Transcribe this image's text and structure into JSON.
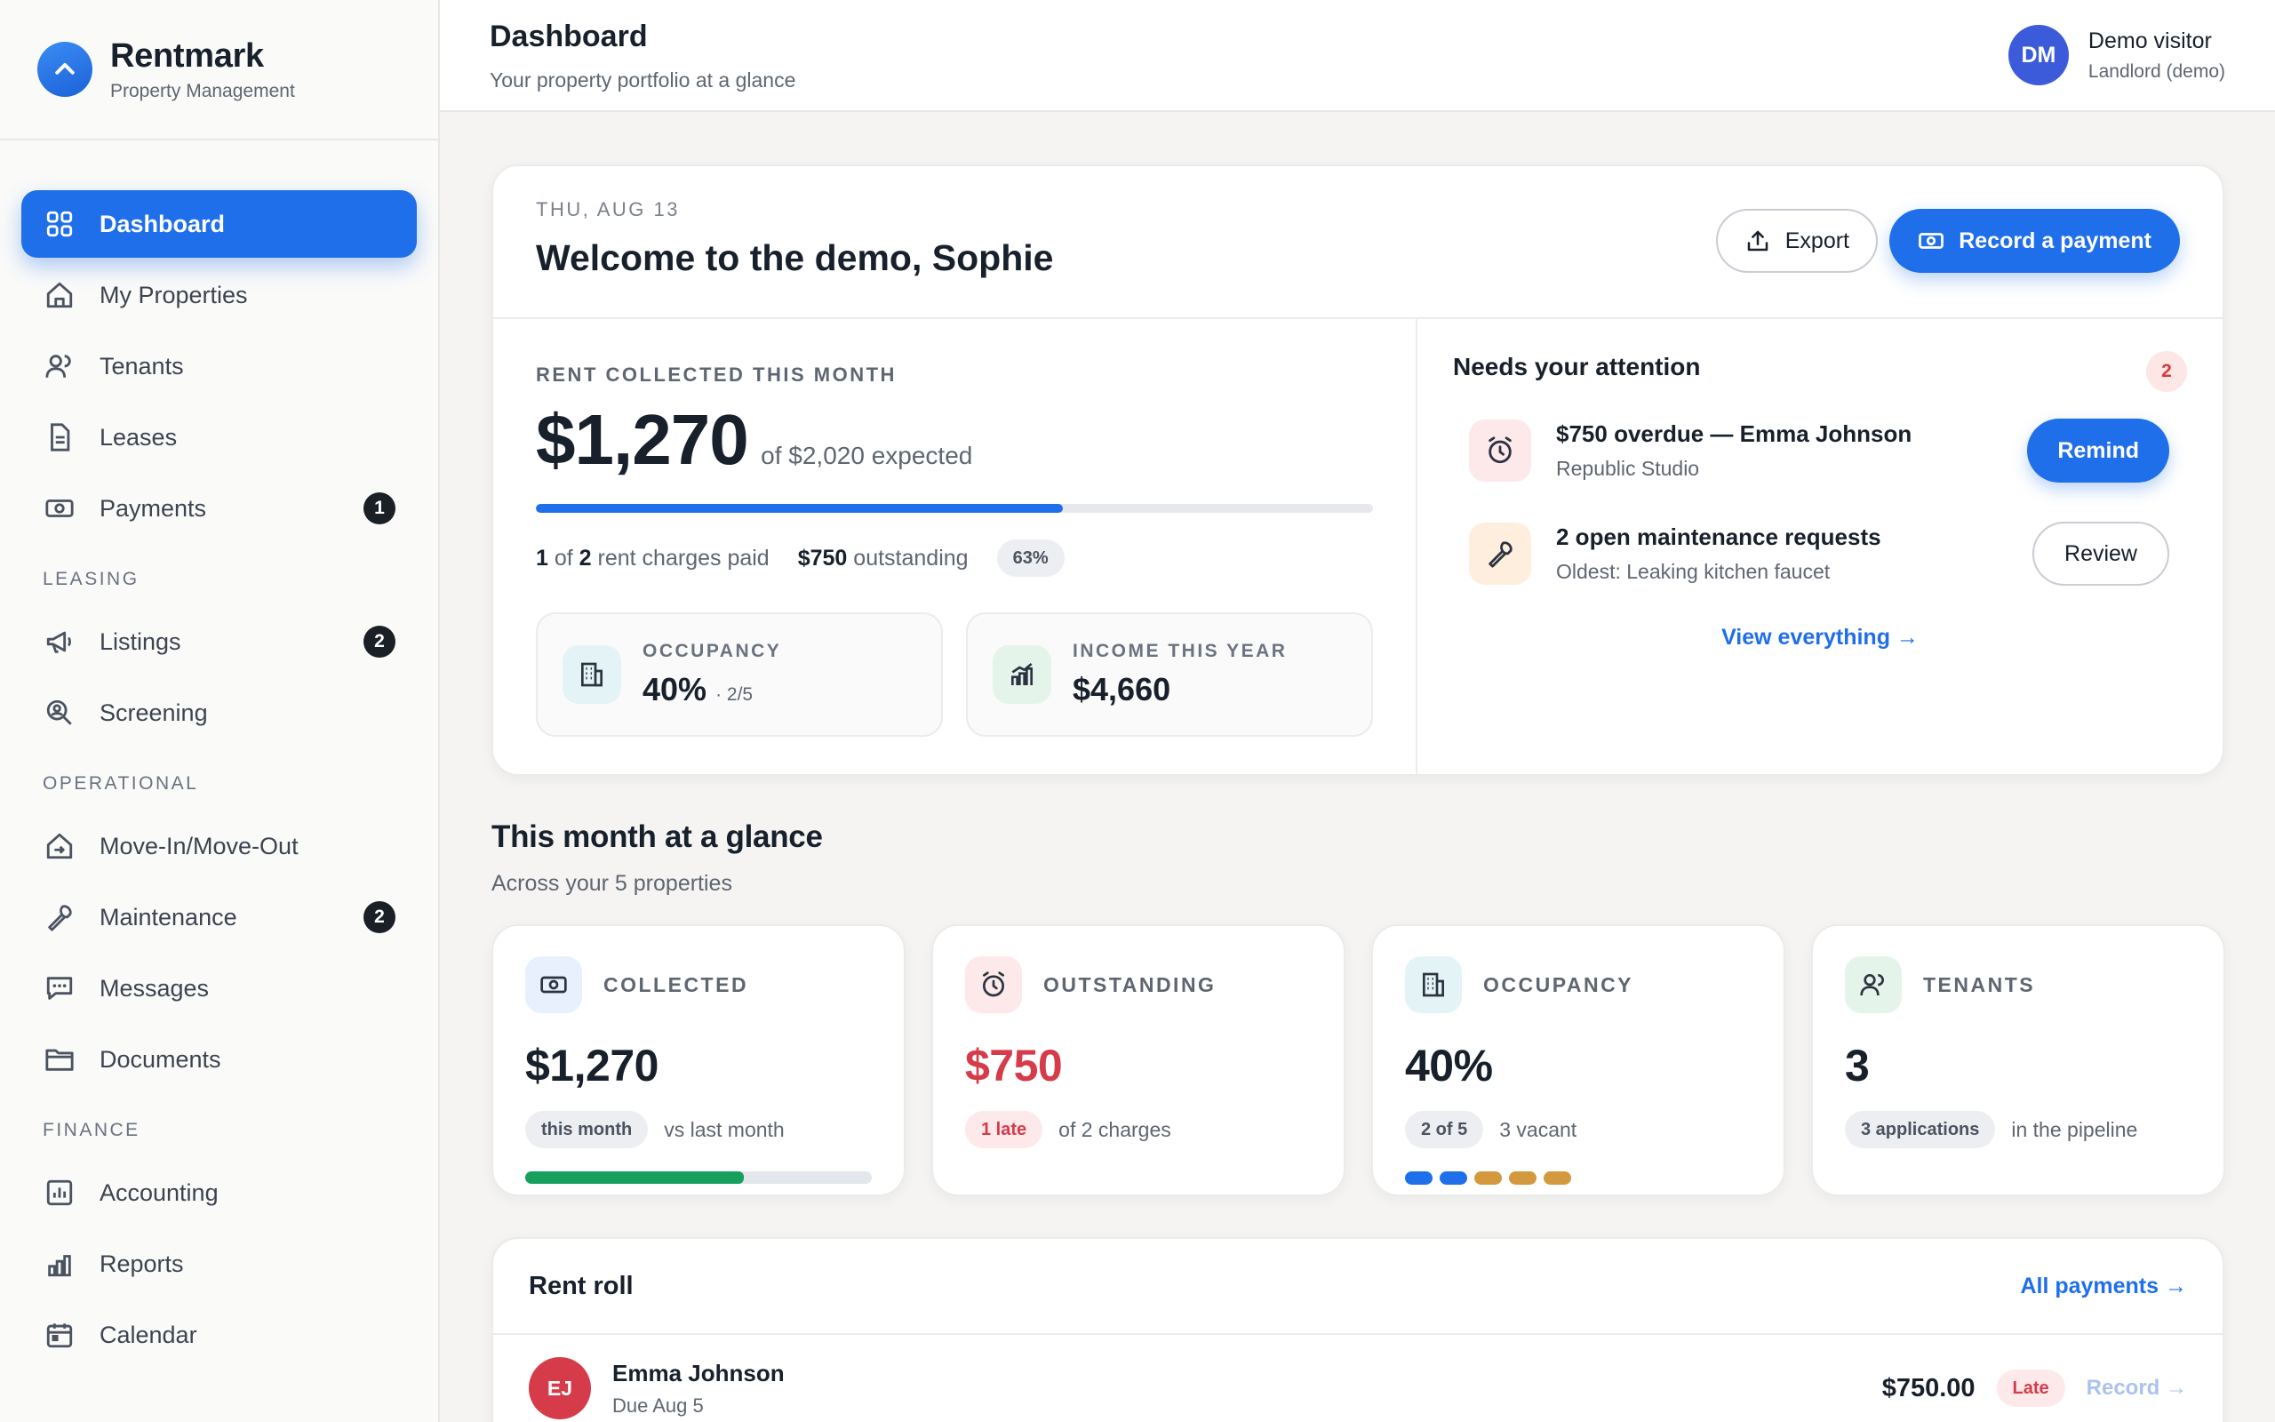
{
  "brand": {
    "name": "Rentmark",
    "subtitle": "Property Management"
  },
  "header": {
    "title": "Dashboard",
    "subtitle": "Your property portfolio at a glance",
    "user": {
      "initials": "DM",
      "name": "Demo visitor",
      "role": "Landlord (demo)"
    }
  },
  "sidebar": {
    "items": [
      {
        "label": "Dashboard",
        "icon": "dashboard-icon",
        "active": true
      },
      {
        "label": "My Properties",
        "icon": "home-icon"
      },
      {
        "label": "Tenants",
        "icon": "users-icon"
      },
      {
        "label": "Leases",
        "icon": "document-icon"
      },
      {
        "label": "Payments",
        "icon": "cash-icon",
        "badge": "1"
      }
    ],
    "sections": [
      {
        "title": "LEASING",
        "items": [
          {
            "label": "Listings",
            "icon": "megaphone-icon",
            "badge": "2"
          },
          {
            "label": "Screening",
            "icon": "search-user-icon"
          }
        ]
      },
      {
        "title": "OPERATIONAL",
        "items": [
          {
            "label": "Move-In/Move-Out",
            "icon": "home-arrow-icon"
          },
          {
            "label": "Maintenance",
            "icon": "wrench-icon",
            "badge": "2"
          },
          {
            "label": "Messages",
            "icon": "chat-icon"
          },
          {
            "label": "Documents",
            "icon": "folder-icon"
          }
        ]
      },
      {
        "title": "FINANCE",
        "items": [
          {
            "label": "Accounting",
            "icon": "ledger-icon"
          },
          {
            "label": "Reports",
            "icon": "bar-chart-icon"
          },
          {
            "label": "Calendar",
            "icon": "calendar-icon"
          }
        ]
      }
    ]
  },
  "welcome": {
    "date": "THU, AUG 13",
    "title": "Welcome to the demo, Sophie",
    "export_label": "Export",
    "record_label": "Record a payment",
    "rent": {
      "label": "RENT COLLECTED THIS MONTH",
      "amount": "$1,270",
      "expected": "of $2,020 expected",
      "progress": 0.63,
      "paid_count": "1",
      "of_text": "of",
      "total_count": "2",
      "paid_suffix": "rent charges paid",
      "outstanding_amount": "$750",
      "outstanding_text": "outstanding",
      "percent": "63%"
    },
    "occupancy": {
      "label": "OCCUPANCY",
      "value": "40%",
      "detail": "· 2/5"
    },
    "income": {
      "label": "INCOME THIS YEAR",
      "value": "$4,660"
    },
    "attention": {
      "title": "Needs your attention",
      "count": "2",
      "items": [
        {
          "title": "$750 overdue — Emma Johnson",
          "subtitle": "Republic Studio",
          "action": "Remind",
          "icon": "alarm-clock-icon"
        },
        {
          "title": "2 open maintenance requests",
          "subtitle": "Oldest: Leaking kitchen faucet",
          "action": "Review",
          "icon": "wrench-icon"
        }
      ],
      "view_all": "View everything →"
    }
  },
  "glance": {
    "title": "This month at a glance",
    "subtitle": "Across your 5 properties",
    "cards": [
      {
        "label": "COLLECTED",
        "value": "$1,270",
        "pill": "this month",
        "note": "vs last month",
        "progress": 0.63,
        "icon": "cash-icon"
      },
      {
        "label": "OUTSTANDING",
        "value": "$750",
        "pill": "1 late",
        "note": "of 2 charges",
        "icon": "alarm-clock-icon"
      },
      {
        "label": "OCCUPANCY",
        "value": "40%",
        "pill": "2 of 5",
        "note": "3 vacant",
        "icon": "building-icon",
        "units_occupied": 2,
        "units_total": 5
      },
      {
        "label": "TENANTS",
        "value": "3",
        "pill": "3 applications",
        "note": "in the pipeline",
        "icon": "users-icon"
      }
    ]
  },
  "rent_roll": {
    "title": "Rent roll",
    "all_link": "All payments →",
    "rows": [
      {
        "initials": "EJ",
        "name": "Emma Johnson",
        "due": "Due Aug 5",
        "amount": "$750.00",
        "status": "Late",
        "action": "Record →"
      }
    ]
  },
  "colors": {
    "primary": "#1f6fea",
    "danger": "#d63b4a",
    "success": "#17a05d",
    "vacant": "#d4993f",
    "occupied": "#1f6fea"
  }
}
